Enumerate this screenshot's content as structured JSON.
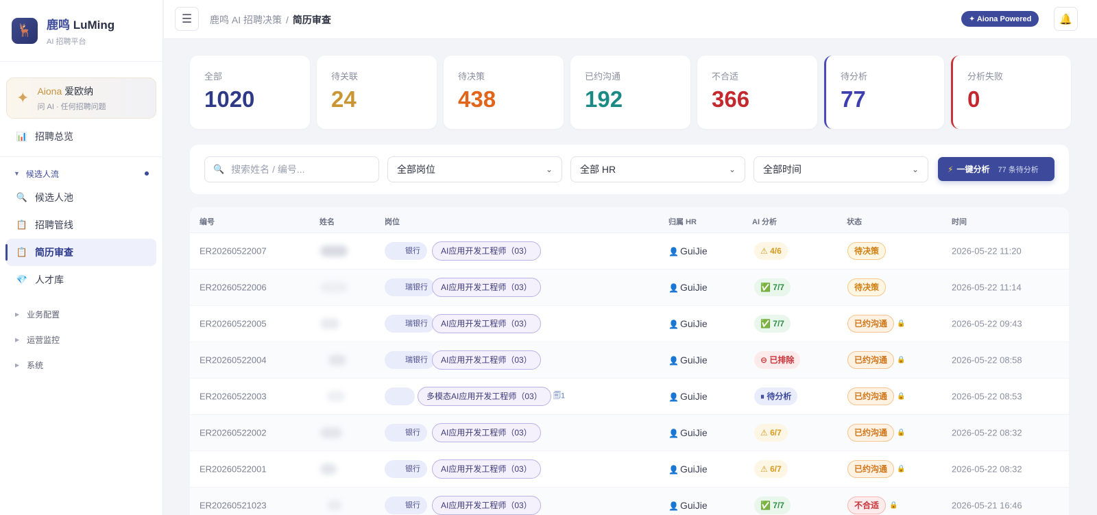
{
  "brand": {
    "title_cn": "鹿鸣",
    "title_en": "LuMing",
    "subtitle": "AI 招聘平台"
  },
  "aiona": {
    "name_en": "Aiona",
    "name_cn": "爱欧纳",
    "subtitle": "问 AI · 任何招聘问题"
  },
  "nav": {
    "overview": "招聘总览",
    "group_candidate": "候选人流",
    "items": [
      "候选人池",
      "招聘管线",
      "简历审查",
      "人才库"
    ],
    "collapsed": [
      "业务配置",
      "运营监控",
      "系统"
    ]
  },
  "header": {
    "crumb_parent": "鹿鸣 AI 招聘决策",
    "crumb_sep": "/",
    "crumb_current": "简历审查",
    "powered": "✦ Aiona Powered"
  },
  "stats": [
    {
      "label": "全部",
      "value": "1020",
      "color": "#2f3a86"
    },
    {
      "label": "待关联",
      "value": "24",
      "color": "#c99633"
    },
    {
      "label": "待决策",
      "value": "438",
      "color": "#e0651a"
    },
    {
      "label": "已约沟通",
      "value": "192",
      "color": "#1c8a84"
    },
    {
      "label": "不合适",
      "value": "366",
      "color": "#c3282e"
    },
    {
      "label": "待分析",
      "value": "77",
      "color": "#3d3fae"
    },
    {
      "label": "分析失败",
      "value": "0",
      "color": "#c3282e"
    }
  ],
  "filters": {
    "search_placeholder": "搜索姓名 / 编号...",
    "position": "全部岗位",
    "hr": "全部 HR",
    "time": "全部时间",
    "analyze_label": "一键分析",
    "analyze_pending": "77 条待分析"
  },
  "table": {
    "headers": [
      "编号",
      "姓名",
      "岗位",
      "归属 HR",
      "AI 分析",
      "状态",
      "时间"
    ],
    "rows": [
      {
        "id": "ER20260522007",
        "bank": "银行",
        "role": "AI应用开发工程师（03）",
        "hr": "GuiJie",
        "ai": "⚠ 4/6",
        "ai_kind": "warn",
        "status": "待决策",
        "st_kind": "dec",
        "lock": false,
        "time": "2026-05-22 11:20"
      },
      {
        "id": "ER20260522006",
        "bank": "瑞银行",
        "role": "AI应用开发工程师（03）",
        "hr": "GuiJie",
        "ai": "✅ 7/7",
        "ai_kind": "ok",
        "status": "待决策",
        "st_kind": "dec",
        "lock": false,
        "time": "2026-05-22 11:14"
      },
      {
        "id": "ER20260522005",
        "bank": "瑞银行",
        "role": "AI应用开发工程师（03）",
        "hr": "GuiJie",
        "ai": "✅ 7/7",
        "ai_kind": "ok",
        "status": "已约沟通",
        "st_kind": "comm",
        "lock": true,
        "time": "2026-05-22 09:43"
      },
      {
        "id": "ER20260522004",
        "bank": "瑞银行",
        "role": "AI应用开发工程师（03）",
        "hr": "GuiJie",
        "ai": "⊖ 已排除",
        "ai_kind": "ex",
        "status": "已约沟通",
        "st_kind": "comm",
        "lock": true,
        "time": "2026-05-22 08:58"
      },
      {
        "id": "ER20260522003",
        "bank": "",
        "role": "多模态AI应用开发工程师（03）",
        "hr": "GuiJie",
        "ai": "⏸ 待分析",
        "ai_kind": "pend",
        "status": "已约沟通",
        "st_kind": "comm",
        "lock": true,
        "time": "2026-05-22 08:53",
        "extra": "1"
      },
      {
        "id": "ER20260522002",
        "bank": "银行",
        "role": "AI应用开发工程师（03）",
        "hr": "GuiJie",
        "ai": "⚠ 6/7",
        "ai_kind": "warn",
        "status": "已约沟通",
        "st_kind": "comm",
        "lock": true,
        "time": "2026-05-22 08:32"
      },
      {
        "id": "ER20260522001",
        "bank": "银行",
        "role": "AI应用开发工程师（03）",
        "hr": "GuiJie",
        "ai": "⚠ 6/7",
        "ai_kind": "warn",
        "status": "已约沟通",
        "st_kind": "comm",
        "lock": true,
        "time": "2026-05-22 08:32"
      },
      {
        "id": "ER20260521023",
        "bank": "银行",
        "role": "AI应用开发工程师（03）",
        "hr": "GuiJie",
        "ai": "✅ 7/7",
        "ai_kind": "ok",
        "status": "不合适",
        "st_kind": "unfit",
        "lock": true,
        "time": "2026-05-21 16:46"
      }
    ]
  }
}
